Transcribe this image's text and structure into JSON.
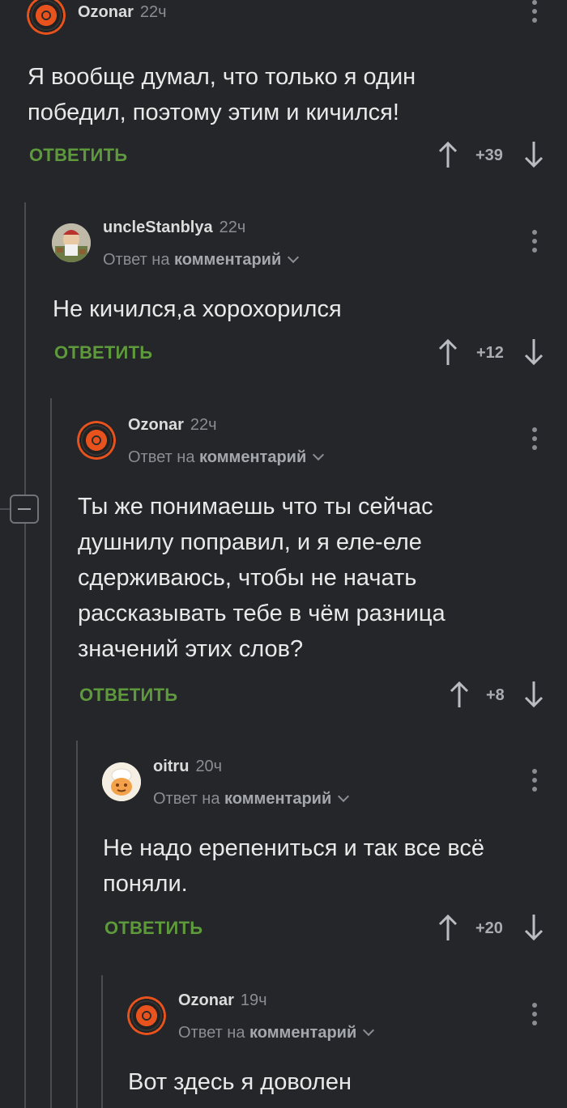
{
  "labels": {
    "reply_to_prefix": "Ответ на",
    "reply_to_target": "комментарий",
    "reply_action": "ОТВЕТИТЬ"
  },
  "comments": [
    {
      "username": "Ozonar",
      "time": "22ч",
      "avatar": "vinyl-record-icon",
      "text": "Я вообще думал, что только я один победил, поэтому этим и кичился!",
      "score": "+39"
    },
    {
      "username": "uncleStanblya",
      "time": "22ч",
      "avatar": "character-avatar",
      "text": "Не кичился,а хорохорился",
      "score": "+12"
    },
    {
      "username": "Ozonar",
      "time": "22ч",
      "avatar": "vinyl-record-icon",
      "text": "Ты же понимаешь что ты сейчас душнилу поправил, и я еле-еле сдерживаюсь, чтобы не начать рассказывать тебе в чём разница значений этих слов?",
      "score": "+8"
    },
    {
      "username": "oitru",
      "time": "20ч",
      "avatar": "chef-avatar",
      "text": "Не надо ерепениться и так все всё поняли.",
      "score": "+20"
    },
    {
      "username": "Ozonar",
      "time": "19ч",
      "avatar": "vinyl-record-icon",
      "text": "Вот здесь я доволен",
      "score": ""
    }
  ],
  "colors": {
    "background": "#24262a",
    "reply_action": "#5e9a3c",
    "avatar_accent": "#e8521c"
  }
}
